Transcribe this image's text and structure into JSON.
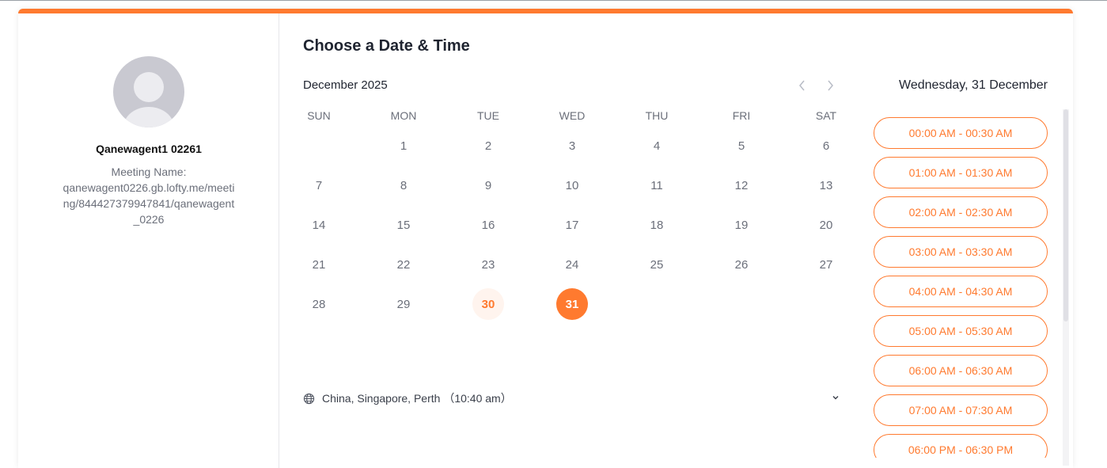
{
  "host": {
    "name": "Qanewagent1 02261",
    "meeting_label": "Meeting Name:",
    "meeting_url": "qanewagent0226.gb.lofty.me/meeting/844427379947841/qanewagent_0226"
  },
  "main": {
    "title": "Choose a Date & Time",
    "month": "December 2025"
  },
  "calendar": {
    "weekdays": [
      "SUN",
      "MON",
      "TUE",
      "WED",
      "THU",
      "FRI",
      "SAT"
    ],
    "weeks": [
      [
        "",
        "1",
        "2",
        "3",
        "4",
        "5",
        "6"
      ],
      [
        "7",
        "8",
        "9",
        "10",
        "11",
        "12",
        "13"
      ],
      [
        "14",
        "15",
        "16",
        "17",
        "18",
        "19",
        "20"
      ],
      [
        "21",
        "22",
        "23",
        "24",
        "25",
        "26",
        "27"
      ],
      [
        "28",
        "29",
        "30",
        "31",
        "",
        "",
        ""
      ]
    ],
    "today": "30",
    "selected": "31"
  },
  "timezone": {
    "label": "China, Singapore, Perth （10:40 am）"
  },
  "slots_panel": {
    "date_heading": "Wednesday, 31 December",
    "slots": [
      "00:00 AM - 00:30 AM",
      "01:00 AM - 01:30 AM",
      "02:00 AM - 02:30 AM",
      "03:00 AM - 03:30 AM",
      "04:00 AM - 04:30 AM",
      "05:00 AM - 05:30 AM",
      "06:00 AM - 06:30 AM",
      "07:00 AM - 07:30 AM",
      "06:00 PM - 06:30 PM"
    ]
  },
  "colors": {
    "accent": "#ff7a2f",
    "today_bg": "#fff4ee",
    "muted_text": "#6b6f7a"
  },
  "icons": {
    "prev": "chevron-left-icon",
    "next": "chevron-right-icon",
    "timezone": "globe-icon",
    "dropdown": "chevron-down-icon"
  }
}
